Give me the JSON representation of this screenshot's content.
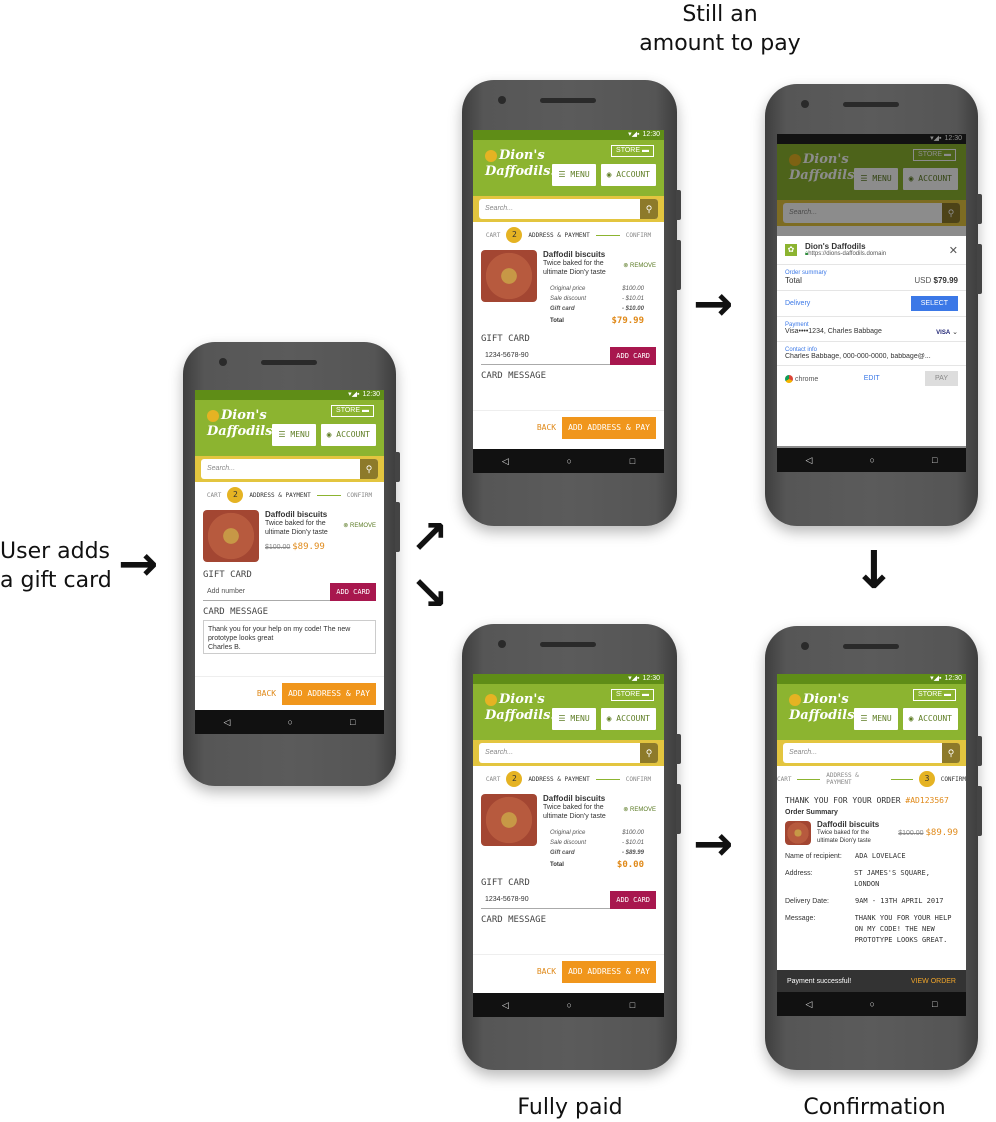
{
  "captions": {
    "left": "User adds\na gift card",
    "top": "Still an\namount to pay",
    "bottom_mid": "Fully paid",
    "bottom_right": "Confirmation"
  },
  "status": {
    "time": "12:30"
  },
  "store": {
    "logo": "Dion's Daffodils.",
    "store_label": "STORE",
    "menu": "MENU",
    "account": "ACCOUNT",
    "search_placeholder": "Search...",
    "steps": [
      "CART",
      "ADDRESS & PAYMENT",
      "CONFIRM"
    ],
    "step_num": "2",
    "step_num_confirm": "3"
  },
  "product": {
    "name": "Daffodil biscuits",
    "desc": "Twice baked for the ultimate Dion'y taste",
    "remove": "REMOVE",
    "old_price": "$100.00",
    "price": "$89.99"
  },
  "summary": {
    "original_label": "Original price",
    "original": "$100.00",
    "discount_label": "Sale discount",
    "discount": "- $10.01",
    "gift_label": "Gift card",
    "gift_a": "- $10.00",
    "gift_b": "- $89.99",
    "total_label": "Total",
    "total_a": "$79.99",
    "total_b": "$0.00"
  },
  "gift": {
    "label": "GIFT CARD",
    "placeholder": "Add number",
    "number": "1234-5678-90",
    "btn": "ADD CARD",
    "msg_label": "CARD MESSAGE",
    "msg": "Thank you for your help on my code! The new prototype looks great\nCharles B."
  },
  "footer": {
    "back": "BACK",
    "pay": "ADD ADDRESS & PAY"
  },
  "payment_sheet": {
    "merchant": "Dion's Daffodils",
    "url": "https://dions-daffodils.domain",
    "order_summary": "Order summary",
    "total_label": "Total",
    "currency": "USD",
    "total": "$79.99",
    "delivery": "Delivery",
    "select": "SELECT",
    "payment": "Payment",
    "card": "Visa••••1234, Charles Babbage",
    "card_brand": "VISA",
    "contact": "Contact info",
    "contact_val": "Charles Babbage, 000-000-0000, babbage@...",
    "chrome": "chrome",
    "edit": "EDIT",
    "pay": "PAY"
  },
  "confirmation": {
    "thanks": "THANK YOU FOR YOUR ORDER",
    "order_no": "#AD123567",
    "order_summary": "Order Summary",
    "recipient_label": "Name of recipient:",
    "recipient": "ADA LOVELACE",
    "address_label": "Address:",
    "address": "ST JAMES'S SQUARE, LONDON",
    "date_label": "Delivery Date:",
    "date": "9AM - 13TH APRIL 2017",
    "message_label": "Message:",
    "message": "THANK YOU FOR YOUR HELP ON MY CODE! THE NEW PROTOTYPE LOOKS GREAT. CHARLES B.",
    "snack": "Payment successful!",
    "view_order": "VIEW ORDER"
  }
}
